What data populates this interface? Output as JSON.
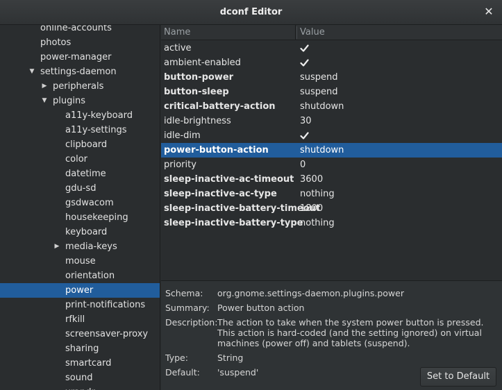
{
  "window": {
    "title": "dconf Editor",
    "close_glyph": "✕"
  },
  "tree": {
    "partial_top_label": "online-accounts",
    "items": [
      {
        "label": "photos",
        "level": 0,
        "arrow": "none"
      },
      {
        "label": "power-manager",
        "level": 0,
        "arrow": "none"
      },
      {
        "label": "settings-daemon",
        "level": 0,
        "arrow": "down"
      },
      {
        "label": "peripherals",
        "level": 1,
        "arrow": "right"
      },
      {
        "label": "plugins",
        "level": 1,
        "arrow": "down"
      },
      {
        "label": "a11y-keyboard",
        "level": 2,
        "arrow": "none"
      },
      {
        "label": "a11y-settings",
        "level": 2,
        "arrow": "none"
      },
      {
        "label": "clipboard",
        "level": 2,
        "arrow": "none"
      },
      {
        "label": "color",
        "level": 2,
        "arrow": "none"
      },
      {
        "label": "datetime",
        "level": 2,
        "arrow": "none"
      },
      {
        "label": "gdu-sd",
        "level": 2,
        "arrow": "none"
      },
      {
        "label": "gsdwacom",
        "level": 2,
        "arrow": "none"
      },
      {
        "label": "housekeeping",
        "level": 2,
        "arrow": "none"
      },
      {
        "label": "keyboard",
        "level": 2,
        "arrow": "none"
      },
      {
        "label": "media-keys",
        "level": 2,
        "arrow": "right"
      },
      {
        "label": "mouse",
        "level": 2,
        "arrow": "none"
      },
      {
        "label": "orientation",
        "level": 2,
        "arrow": "none"
      },
      {
        "label": "power",
        "level": 2,
        "arrow": "none",
        "selected": true
      },
      {
        "label": "print-notifications",
        "level": 2,
        "arrow": "none"
      },
      {
        "label": "rfkill",
        "level": 2,
        "arrow": "none"
      },
      {
        "label": "screensaver-proxy",
        "level": 2,
        "arrow": "none"
      },
      {
        "label": "sharing",
        "level": 2,
        "arrow": "none"
      },
      {
        "label": "smartcard",
        "level": 2,
        "arrow": "none"
      },
      {
        "label": "sound",
        "level": 2,
        "arrow": "none"
      },
      {
        "label": "xrandr",
        "level": 2,
        "arrow": "none"
      }
    ]
  },
  "table": {
    "columns": {
      "name": "Name",
      "value": "Value"
    },
    "rows": [
      {
        "key": "active",
        "value": "",
        "checkbox": true,
        "bold": false
      },
      {
        "key": "ambient-enabled",
        "value": "",
        "checkbox": true,
        "bold": false
      },
      {
        "key": "button-power",
        "value": "suspend",
        "bold": true
      },
      {
        "key": "button-sleep",
        "value": "suspend",
        "bold": true
      },
      {
        "key": "critical-battery-action",
        "value": "shutdown",
        "bold": true
      },
      {
        "key": "idle-brightness",
        "value": "30",
        "bold": false
      },
      {
        "key": "idle-dim",
        "value": "",
        "checkbox": true,
        "bold": false
      },
      {
        "key": "power-button-action",
        "value": "shutdown",
        "bold": true,
        "selected": true
      },
      {
        "key": "priority",
        "value": "0",
        "bold": false
      },
      {
        "key": "sleep-inactive-ac-timeout",
        "value": "3600",
        "bold": true
      },
      {
        "key": "sleep-inactive-ac-type",
        "value": "nothing",
        "bold": true
      },
      {
        "key": "sleep-inactive-battery-timeout",
        "value": "1800",
        "bold": true
      },
      {
        "key": "sleep-inactive-battery-type",
        "value": "nothing",
        "bold": true
      }
    ]
  },
  "details": {
    "schema_label": "Schema:",
    "schema": "org.gnome.settings-daemon.plugins.power",
    "summary_label": "Summary:",
    "summary": "Power button action",
    "description_label": "Description:",
    "description": "The action to take when the system power button is pressed. This action is hard-coded (and the setting ignored) on virtual machines (power off) and tablets (suspend).",
    "type_label": "Type:",
    "type": "String",
    "default_label": "Default:",
    "default": "'suspend'",
    "set_default_button": "Set to Default"
  },
  "colors": {
    "selection": "#215d9c",
    "background": "#2a2d2f"
  }
}
